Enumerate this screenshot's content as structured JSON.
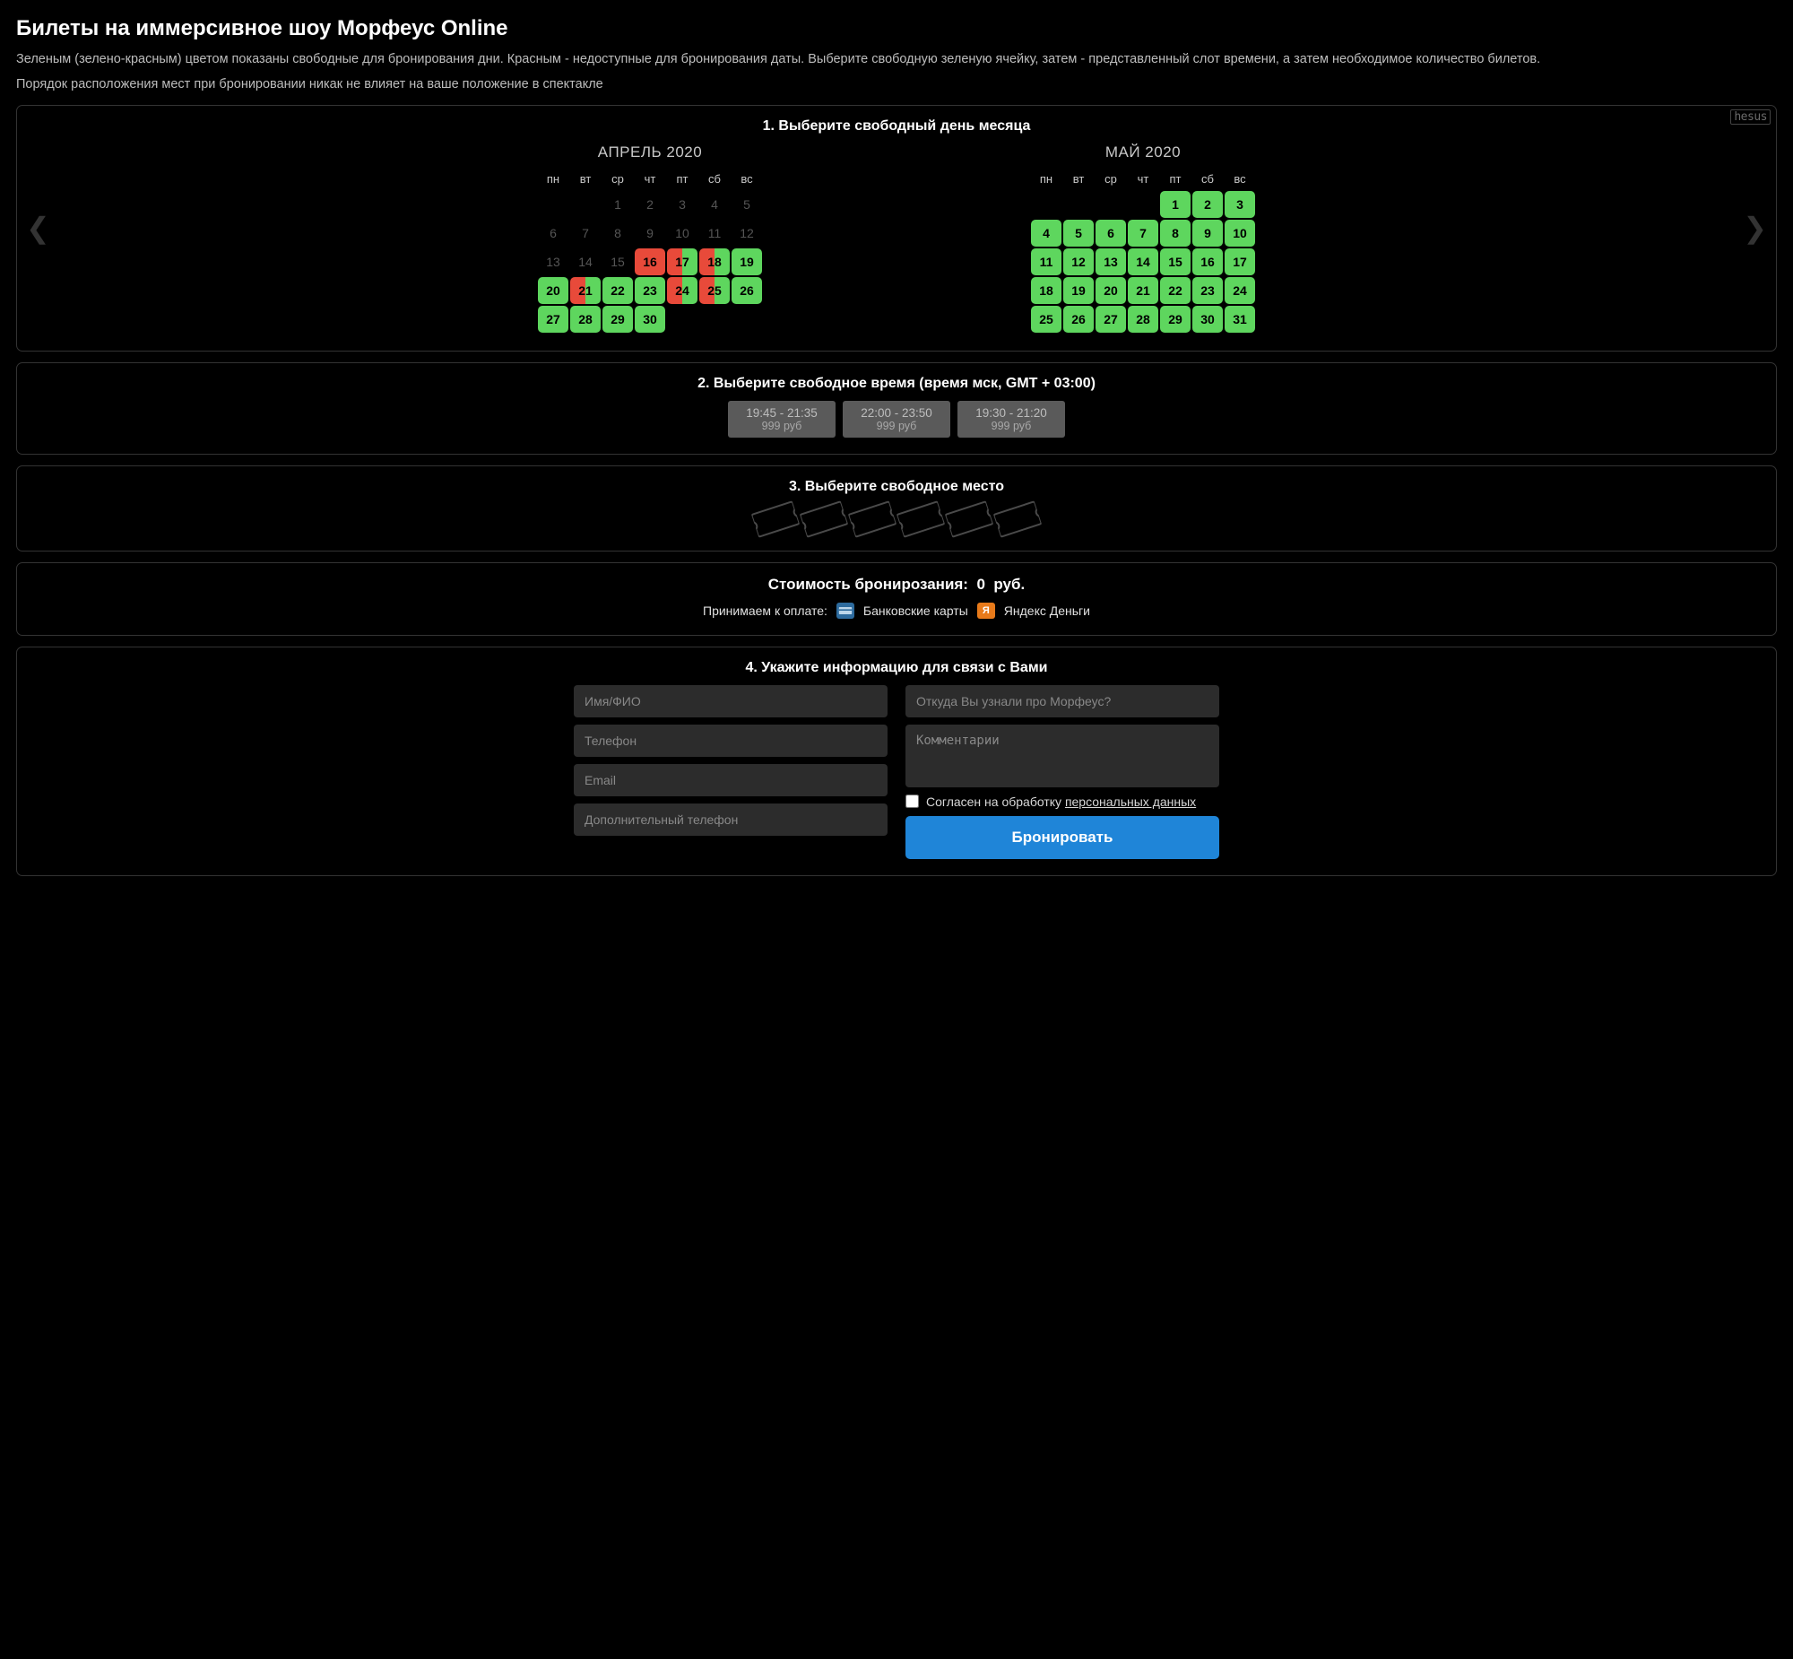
{
  "header": {
    "title": "Билеты на иммерсивное шоу Морфеус Online",
    "intro1": "Зеленым (зелено-красным) цветом показаны свободные для бронирования дни. Красным - недоступные для бронирования даты. Выберите свободную зеленую ячейку, затем - представленный слот времени, а затем необходимое количество билетов.",
    "intro2": "Порядок расположения мест при бронировании никак не влияет на ваше положение в спектакле"
  },
  "step1": {
    "title": "1. Выберите свободный день месяца",
    "brand": "hesus",
    "dow": [
      "пн",
      "вт",
      "ср",
      "чт",
      "пт",
      "сб",
      "вс"
    ],
    "months": [
      {
        "title": "АПРЕЛЬ 2020",
        "weeks": [
          [
            {
              "n": "",
              "s": "empty"
            },
            {
              "n": "",
              "s": "empty"
            },
            {
              "n": "1",
              "s": "past"
            },
            {
              "n": "2",
              "s": "past"
            },
            {
              "n": "3",
              "s": "past"
            },
            {
              "n": "4",
              "s": "past"
            },
            {
              "n": "5",
              "s": "past"
            }
          ],
          [
            {
              "n": "6",
              "s": "past"
            },
            {
              "n": "7",
              "s": "past"
            },
            {
              "n": "8",
              "s": "past"
            },
            {
              "n": "9",
              "s": "past"
            },
            {
              "n": "10",
              "s": "past"
            },
            {
              "n": "11",
              "s": "past"
            },
            {
              "n": "12",
              "s": "past"
            }
          ],
          [
            {
              "n": "13",
              "s": "past"
            },
            {
              "n": "14",
              "s": "past"
            },
            {
              "n": "15",
              "s": "past"
            },
            {
              "n": "16",
              "s": "red"
            },
            {
              "n": "17",
              "s": "split"
            },
            {
              "n": "18",
              "s": "split"
            },
            {
              "n": "19",
              "s": "green"
            }
          ],
          [
            {
              "n": "20",
              "s": "green"
            },
            {
              "n": "21",
              "s": "split"
            },
            {
              "n": "22",
              "s": "green"
            },
            {
              "n": "23",
              "s": "green"
            },
            {
              "n": "24",
              "s": "split"
            },
            {
              "n": "25",
              "s": "split"
            },
            {
              "n": "26",
              "s": "green"
            }
          ],
          [
            {
              "n": "27",
              "s": "green"
            },
            {
              "n": "28",
              "s": "green"
            },
            {
              "n": "29",
              "s": "green"
            },
            {
              "n": "30",
              "s": "green"
            },
            {
              "n": "",
              "s": "empty"
            },
            {
              "n": "",
              "s": "empty"
            },
            {
              "n": "",
              "s": "empty"
            }
          ]
        ]
      },
      {
        "title": "МАЙ 2020",
        "weeks": [
          [
            {
              "n": "",
              "s": "empty"
            },
            {
              "n": "",
              "s": "empty"
            },
            {
              "n": "",
              "s": "empty"
            },
            {
              "n": "",
              "s": "empty"
            },
            {
              "n": "1",
              "s": "green"
            },
            {
              "n": "2",
              "s": "green"
            },
            {
              "n": "3",
              "s": "green"
            }
          ],
          [
            {
              "n": "4",
              "s": "green"
            },
            {
              "n": "5",
              "s": "green"
            },
            {
              "n": "6",
              "s": "green"
            },
            {
              "n": "7",
              "s": "green"
            },
            {
              "n": "8",
              "s": "green"
            },
            {
              "n": "9",
              "s": "green"
            },
            {
              "n": "10",
              "s": "green"
            }
          ],
          [
            {
              "n": "11",
              "s": "green"
            },
            {
              "n": "12",
              "s": "green"
            },
            {
              "n": "13",
              "s": "green"
            },
            {
              "n": "14",
              "s": "green"
            },
            {
              "n": "15",
              "s": "green"
            },
            {
              "n": "16",
              "s": "green"
            },
            {
              "n": "17",
              "s": "green"
            }
          ],
          [
            {
              "n": "18",
              "s": "green"
            },
            {
              "n": "19",
              "s": "green"
            },
            {
              "n": "20",
              "s": "green"
            },
            {
              "n": "21",
              "s": "green"
            },
            {
              "n": "22",
              "s": "green"
            },
            {
              "n": "23",
              "s": "green"
            },
            {
              "n": "24",
              "s": "green"
            }
          ],
          [
            {
              "n": "25",
              "s": "green"
            },
            {
              "n": "26",
              "s": "green"
            },
            {
              "n": "27",
              "s": "green"
            },
            {
              "n": "28",
              "s": "green"
            },
            {
              "n": "29",
              "s": "green"
            },
            {
              "n": "30",
              "s": "green"
            },
            {
              "n": "31",
              "s": "green"
            }
          ]
        ]
      }
    ]
  },
  "step2": {
    "title": "2. Выберите свободное время (время мск, GMT + 03:00)",
    "slots": [
      {
        "time": "19:45 - 21:35",
        "price": "999 руб"
      },
      {
        "time": "22:00 - 23:50",
        "price": "999 руб"
      },
      {
        "time": "19:30 - 21:20",
        "price": "999 руб"
      }
    ]
  },
  "step3": {
    "title": "3. Выберите свободное место",
    "ticket_count": 6
  },
  "cost": {
    "label": "Стоимость бронирозания:",
    "value": "0",
    "currency": "руб.",
    "accept_label": "Принимаем к оплате:",
    "method_card": "Банковские карты",
    "method_yandex": "Яндекс Деньги"
  },
  "step4": {
    "title": "4. Укажите информацию для связи с Вами",
    "ph_name": "Имя/ФИО",
    "ph_phone": "Телефон",
    "ph_email": "Email",
    "ph_phone2": "Дополнительный телефон",
    "ph_source": "Откуда Вы узнали про Морфеус?",
    "ph_comment": "Комментарии",
    "consent_pre": "Согласен на обработку ",
    "consent_link": "персональных данных",
    "submit": "Бронировать"
  }
}
